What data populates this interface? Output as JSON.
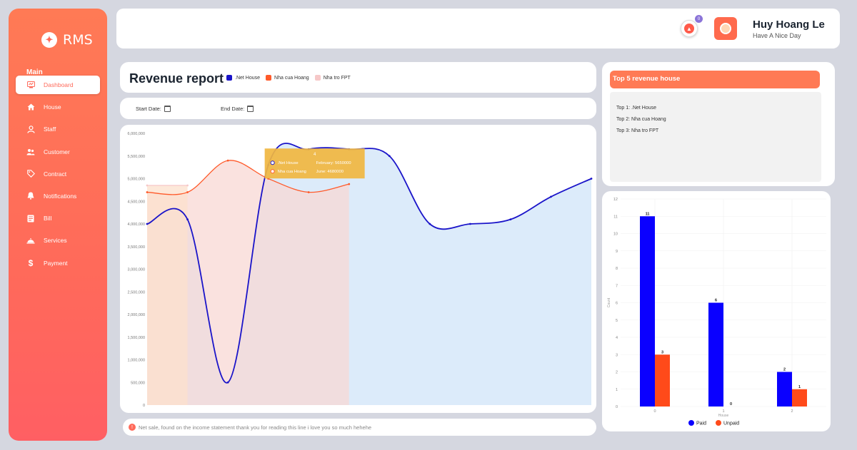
{
  "brand": {
    "name": "RMS",
    "icon": "rms-logo-icon"
  },
  "nav": {
    "section": "Main",
    "items": [
      {
        "label": "Dashboard",
        "icon": "dashboard-icon",
        "active": true
      },
      {
        "label": "House",
        "icon": "home-icon"
      },
      {
        "label": "Staff",
        "icon": "user-icon"
      },
      {
        "label": "Customer",
        "icon": "users-icon"
      },
      {
        "label": "Contract",
        "icon": "tag-icon"
      },
      {
        "label": "Notifications",
        "icon": "bell-icon"
      },
      {
        "label": "Bill",
        "icon": "receipt-icon"
      },
      {
        "label": "Services",
        "icon": "dish-icon"
      },
      {
        "label": "Payment",
        "icon": "dollar-icon"
      }
    ]
  },
  "topbar": {
    "notification_count": "0",
    "user_name": "Huy Hoang Le",
    "user_greeting": "Have A Nice Day"
  },
  "revenue": {
    "title": "Revenue report",
    "legend": [
      {
        "label": ".Net House",
        "color": "#1a14c9"
      },
      {
        "label": "Nha cua Hoang",
        "color": "#ff5a2a"
      },
      {
        "label": "Nha tro FPT",
        "color": "#f6c8c8"
      }
    ],
    "start_date_label": "Start Date:",
    "end_date_label": "End Date:",
    "footer_note": "Net sale, found on the income statement  thank you for reading this line i love you so much hehehe"
  },
  "chart_data": [
    {
      "type": "area",
      "title": "Revenue report",
      "ylim": [
        0,
        6000000
      ],
      "y_ticks": [
        "0",
        "500,000",
        "1,000,000",
        "1,500,000",
        "2,000,000",
        "2,500,000",
        "3,000,000",
        "3,500,000",
        "4,000,000",
        "4,500,000",
        "5,000,000",
        "5,500,000",
        "6,000,000"
      ],
      "series": [
        {
          "name": ".Net House",
          "color": "#1a14c9",
          "fill": "#dcebfa",
          "values": [
            4000000,
            4100000,
            500000,
            5300000,
            5650000,
            5650000,
            5500000,
            4000000,
            4000000,
            4100000,
            4600000,
            5000000
          ]
        },
        {
          "name": "Nha cua Hoang",
          "color": "#ff5a2a",
          "fill": "#f8d8d4",
          "values": [
            4700000,
            4700000,
            5400000,
            5000000,
            4700000,
            4880000
          ]
        },
        {
          "name": "Nha tro FPT",
          "color": "#f6c8c8",
          "fill": "#fce0cc",
          "values": [
            4850000,
            4850000
          ]
        }
      ],
      "tooltip": {
        "title": "4",
        "lines": [
          {
            "series": ".Net House",
            "text": "February: 5650000"
          },
          {
            "series": "Nha cua Hoang",
            "text": "June: 4680000"
          }
        ]
      }
    },
    {
      "type": "bar",
      "categories": [
        "0",
        "1",
        "2"
      ],
      "xlabel": "House",
      "ylabel": "Count",
      "ylim": [
        0,
        12
      ],
      "legend_position": "bottom",
      "series": [
        {
          "name": "Paid",
          "color": "#0a00ff",
          "values": [
            11,
            6,
            2
          ]
        },
        {
          "name": "Unpaid",
          "color": "#ff4a1a",
          "values": [
            3,
            0,
            1
          ]
        }
      ]
    }
  ],
  "top5": {
    "title": "Top 5 revenue house",
    "items": [
      "Top 1: .Net House",
      "Top 2: Nha cua Hoang",
      "Top 3: Nha tro FPT"
    ]
  }
}
